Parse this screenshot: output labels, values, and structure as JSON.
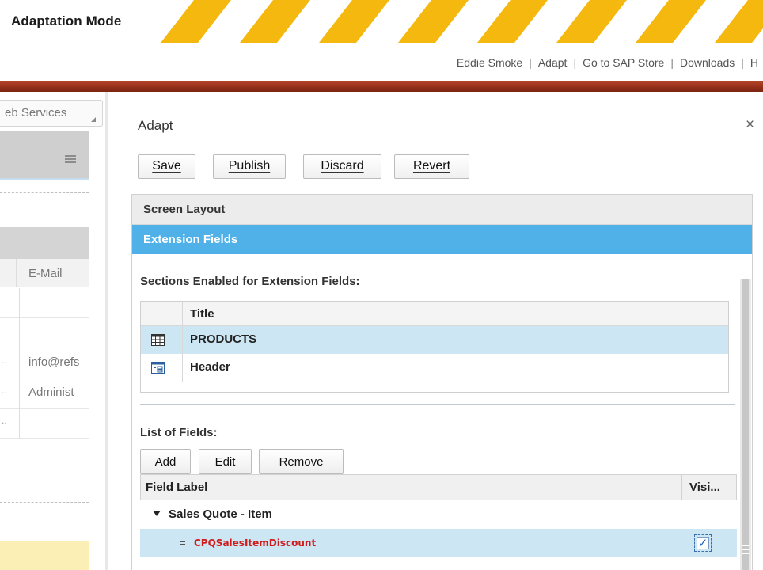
{
  "banner": {
    "title": "Adaptation Mode",
    "stripe_color": "#f5b80f"
  },
  "top_links": {
    "user": "Eddie Smoke",
    "adapt": "Adapt",
    "store": "Go to SAP Store",
    "downloads": "Downloads",
    "help_partial": "H",
    "separator": "|"
  },
  "background_screen": {
    "dropdown_label": "eb Services",
    "column_header": "E-Mail",
    "rows": [
      {
        "prefix": "",
        "text": ""
      },
      {
        "prefix": "",
        "text": ""
      },
      {
        "prefix": "..",
        "text": "info@refs"
      },
      {
        "prefix": "..",
        "text": "Administ"
      },
      {
        "prefix": "..",
        "text": ""
      }
    ]
  },
  "adapt_panel": {
    "title": "Adapt",
    "close_glyph": "×",
    "toolbar": {
      "save": "Save",
      "publish": "Publish",
      "discard": "Discard",
      "revert": "Revert"
    },
    "tabs": {
      "screen_layout": "Screen Layout",
      "extension_fields": "Extension Fields"
    },
    "selected_tab": "Extension Fields",
    "accent_color": "#50b0e8",
    "sections": {
      "heading": "Sections Enabled for Extension Fields:",
      "column_title": "Title",
      "rows": [
        {
          "title": "PRODUCTS",
          "icon": "table-icon",
          "selected": true
        },
        {
          "title": "Header",
          "icon": "form-icon",
          "selected": false
        }
      ]
    },
    "fields": {
      "heading": "List of Fields:",
      "buttons": {
        "add": "Add",
        "edit": "Edit",
        "remove": "Remove"
      },
      "columns": {
        "label": "Field Label",
        "visible": "Visi..."
      },
      "group": "Sales Quote - Item",
      "rows": [
        {
          "label": "CPQSalesItemDiscount",
          "visible": true,
          "label_color": "#d11a1a"
        }
      ],
      "check_glyph": "✓"
    }
  }
}
